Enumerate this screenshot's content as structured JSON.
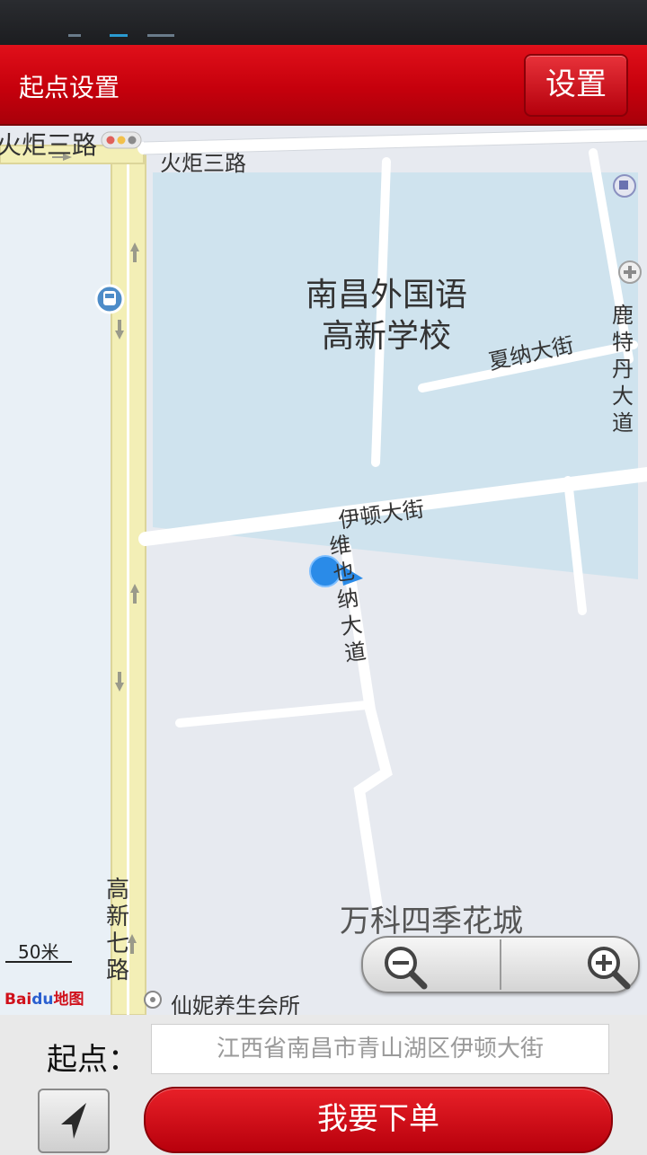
{
  "header": {
    "title": "起点设置",
    "settings_button": "设置"
  },
  "map": {
    "labels": {
      "road_top_left": "火炬三路",
      "road_top": "火炬三路",
      "school_line1": "南昌外国语",
      "school_line2": "高新学校",
      "xiana": "夏纳大街",
      "lute": "鹿特丹大道",
      "yidun": "伊顿大街",
      "weina": "维也纳大道",
      "gaoxin": "高新七路",
      "wanke": "万科四季花城",
      "xianni": "仙妮养生会所"
    },
    "scale": "50米",
    "logo": {
      "bai": "Bai",
      "du": "du",
      "ditu": "地图"
    }
  },
  "panel": {
    "origin_label": "起点：",
    "origin_value": "江西省南昌市青山湖区伊顿大街",
    "order_button": "我要下单"
  }
}
